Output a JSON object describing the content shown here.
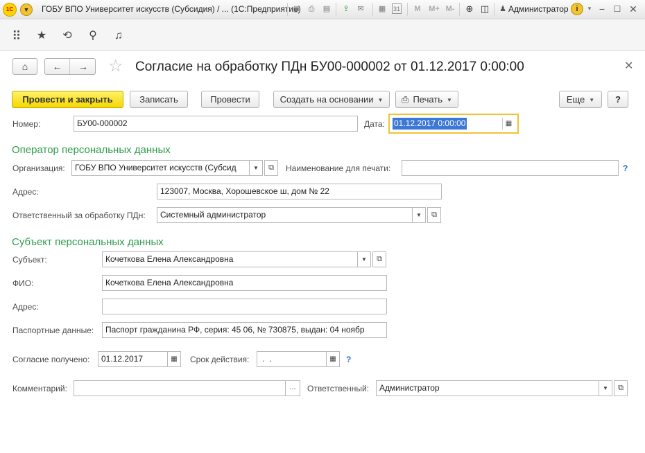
{
  "window": {
    "title": "ГОБУ ВПО Университет искусств (Субсидия) / ...  (1С:Предприятие)",
    "user": "Администратор"
  },
  "toolbar_icons": [
    "save-icon",
    "print-icon",
    "preview-icon",
    "upload-icon",
    "mail-icon",
    "link-icon",
    "calculator-icon",
    "calendar-icon",
    "memory-m-icon",
    "memory-mplus-icon",
    "memory-mminus-icon",
    "zoom-icon",
    "panel-icon",
    "user-icon",
    "info-icon",
    "minimize-icon",
    "maximize-icon",
    "close-icon"
  ],
  "memory": {
    "m": "M",
    "mplus": "M+",
    "mminus": "M-"
  },
  "calendar_day": "31",
  "document": {
    "title": "Согласие на обработку ПДн БУ00-000002 от 01.12.2017 0:00:00"
  },
  "commands": {
    "post_close": "Провести и закрыть",
    "save": "Записать",
    "post": "Провести",
    "create_based": "Создать на основании",
    "print": "Печать",
    "more": "Еще",
    "help": "?"
  },
  "form": {
    "number_label": "Номер:",
    "number_value": "БУ00-000002",
    "date_label": "Дата:",
    "date_value": "01.12.2017  0:00:00",
    "operator_section": "Оператор персональных данных",
    "org_label": "Организация:",
    "org_value": "ГОБУ ВПО Университет искусств (Субсид",
    "print_name_label": "Наименование для печати:",
    "print_name_value": "",
    "address_label": "Адрес:",
    "address_value": "123007, Москва, Хорошевское ш, дом № 22",
    "responsible_pd_label": "Ответственный за обработку ПДн:",
    "responsible_pd_value": "Системный администратор",
    "subject_section": "Субъект персональных данных",
    "subject_label": "Субъект:",
    "subject_value": "Кочеткова Елена Александровна",
    "fio_label": "ФИО:",
    "fio_value": "Кочеткова Елена Александровна",
    "subject_address_label": "Адрес:",
    "subject_address_value": "",
    "passport_label": "Паспортные данные:",
    "passport_value": "Паспорт гражданина РФ, серия: 45 06, № 730875, выдан: 04 ноябр",
    "consent_label": "Согласие получено:",
    "consent_value": "01.12.2017",
    "validity_label": "Срок действия:",
    "validity_value": " .  .",
    "comment_label": "Комментарий:",
    "comment_value": "",
    "comment_btn": "...",
    "responsible_label": "Ответственный:",
    "responsible_value": "Администратор",
    "help_mark": "?"
  }
}
